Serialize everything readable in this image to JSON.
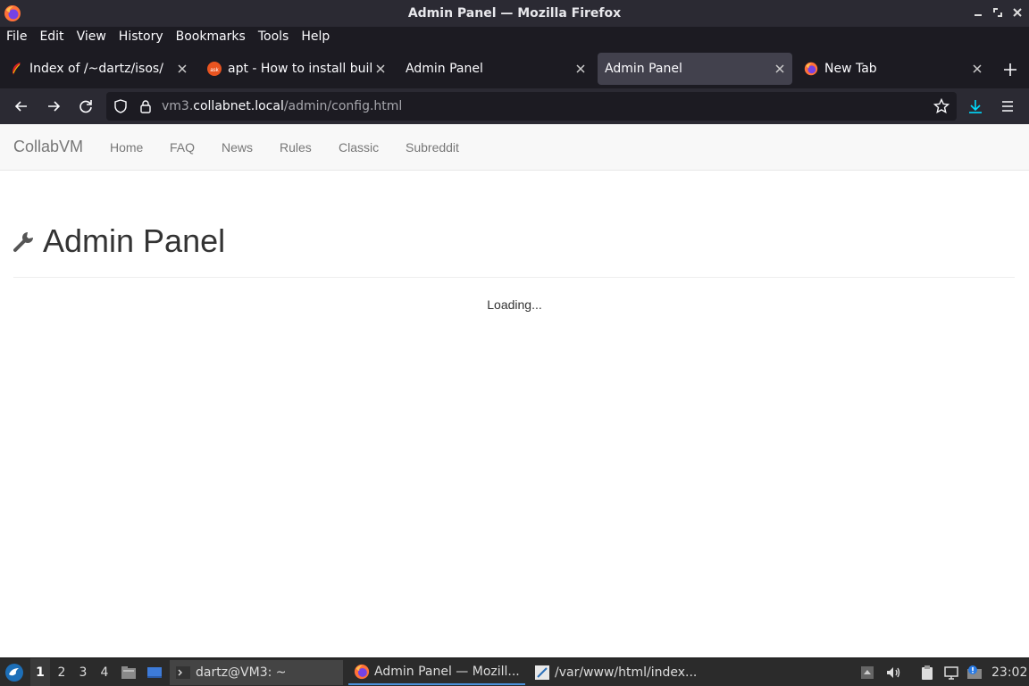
{
  "window": {
    "title": "Admin Panel — Mozilla Firefox"
  },
  "menubar": {
    "items": [
      "File",
      "Edit",
      "View",
      "History",
      "Bookmarks",
      "Tools",
      "Help"
    ]
  },
  "tabs": [
    {
      "title": "Index of /~dartz/isos/",
      "icon": "apache-feather-icon"
    },
    {
      "title": "apt - How to install build-essential",
      "icon": "askubuntu-icon"
    },
    {
      "title": "Admin Panel",
      "icon": ""
    },
    {
      "title": "Admin Panel",
      "icon": "",
      "active": true
    },
    {
      "title": "New Tab",
      "icon": "firefox-icon"
    }
  ],
  "urlbar": {
    "prefix": "vm3.",
    "domain": "collabnet.local",
    "path": "/admin/config.html"
  },
  "site": {
    "brand": "CollabVM",
    "nav": [
      "Home",
      "FAQ",
      "News",
      "Rules",
      "Classic",
      "Subreddit"
    ],
    "heading": "Admin Panel",
    "loading": "Loading..."
  },
  "taskbar": {
    "workspaces": [
      "1",
      "2",
      "3",
      "4"
    ],
    "tasks": [
      {
        "label": "dartz@VM3: ~"
      },
      {
        "label": "Admin Panel — Mozill..."
      },
      {
        "label": "/var/www/html/index..."
      }
    ],
    "clock": "23:02"
  },
  "colors": {
    "accent": "#00ddff",
    "taskbar_active": "#4a90d9",
    "content_bg": "#ffffff"
  }
}
